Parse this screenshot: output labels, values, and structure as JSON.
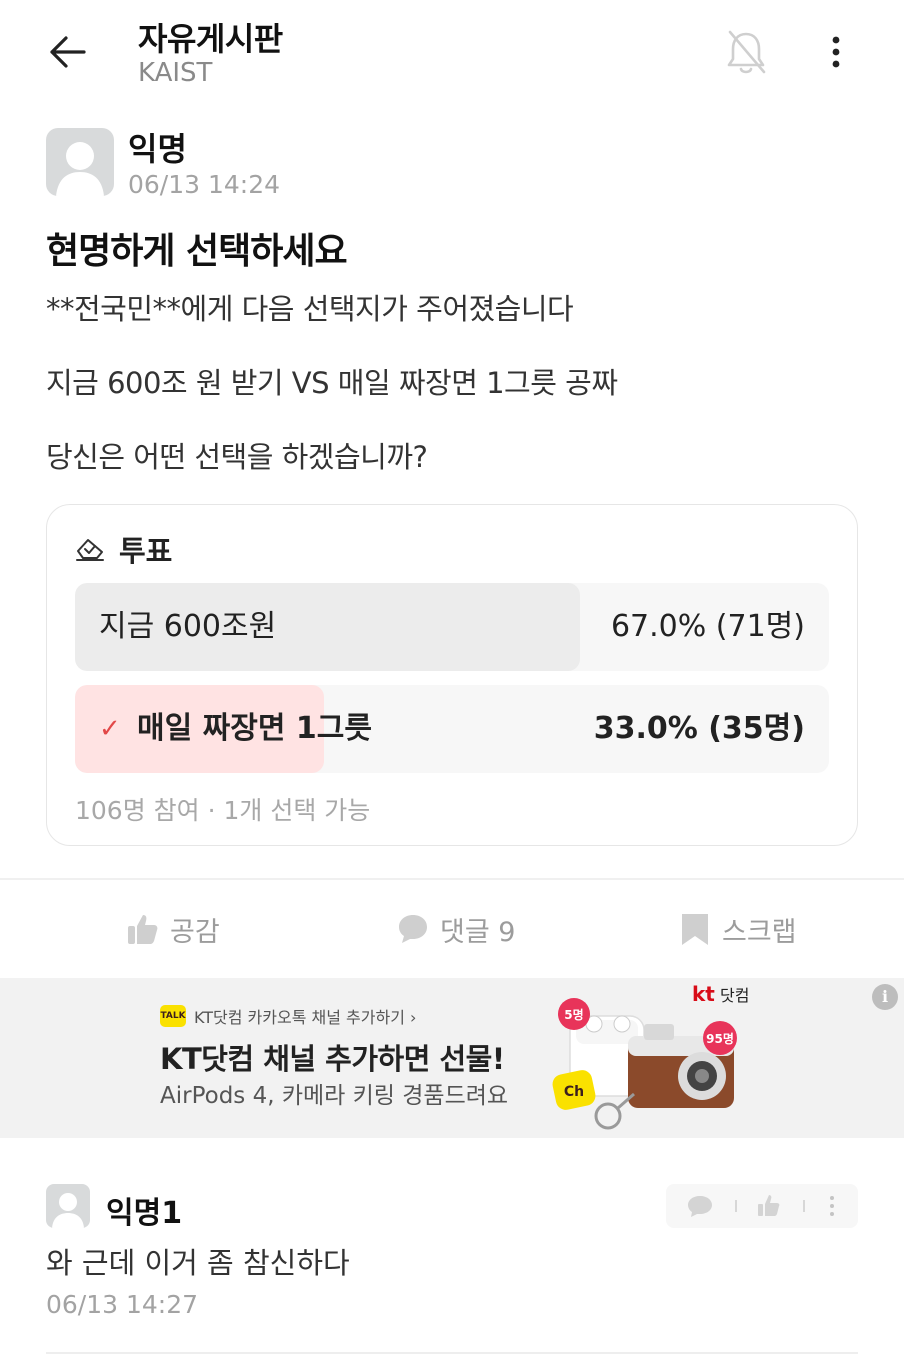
{
  "header": {
    "title": "자유게시판",
    "subtitle": "KAIST"
  },
  "post": {
    "author": "익명",
    "time": "06/13 14:24",
    "title": "현명하게 선택하세요",
    "lines": [
      "**전국민**에게 다음 선택지가 주어졌습니다",
      "지금 600조 원 받기 VS 매일 짜장면 1그릇 공짜",
      "당신은 어떤 선택을 하겠습니까?"
    ]
  },
  "poll": {
    "title": "투표",
    "options": [
      {
        "label": "지금 600조원",
        "result": "67.0% (71명)",
        "share": 0.67,
        "selected": false
      },
      {
        "label": "매일 짜장면 1그릇",
        "result": "33.0% (35명)",
        "share": 0.33,
        "selected": true
      }
    ],
    "footer": "106명 참여 · 1개 선택 가능"
  },
  "actions": {
    "like": "공감",
    "comment": "댓글 9",
    "scrap": "스크랩"
  },
  "ad": {
    "kakao_line": "KT닷컴 카카오톡 채널 추가하기 ›",
    "talk_badge": "TALK",
    "title": "KT닷컴 채널 추가하면 선물!",
    "subtitle": "AirPods 4, 카메라 키링 경품드려요",
    "brand_mark": "kt",
    "brand_name": "닷컴",
    "badge_left": "5명",
    "badge_right": "95명",
    "ch_badge": "Ch",
    "info": "i"
  },
  "comment": {
    "author": "익명1",
    "body": "와 근데 이거 좀 참신하다",
    "time": "06/13 14:27"
  },
  "colors": {
    "accent": "#e24848",
    "selected_fill": "#ffe3e3",
    "option_fill": "#ececec",
    "muted": "#a3a3a3"
  }
}
